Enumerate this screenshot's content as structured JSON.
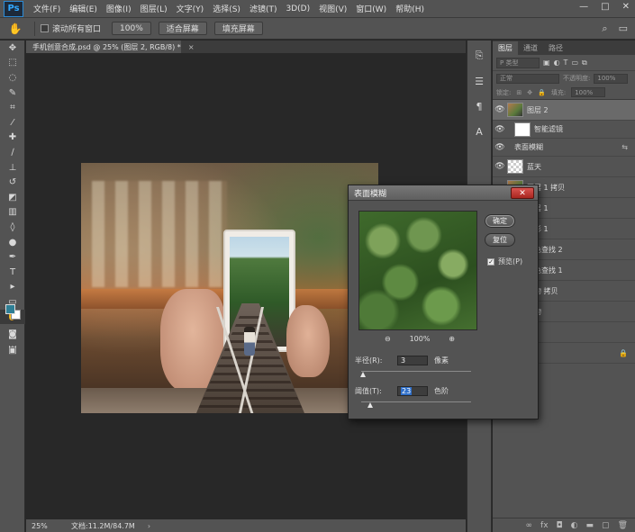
{
  "app": {
    "logo": "Ps"
  },
  "menu": [
    "文件(F)",
    "编辑(E)",
    "图像(I)",
    "图层(L)",
    "文字(Y)",
    "选择(S)",
    "滤镜(T)",
    "3D(D)",
    "视图(V)",
    "窗口(W)",
    "帮助(H)"
  ],
  "window_controls": [
    "—",
    "□",
    "✕"
  ],
  "options_bar": {
    "scroll_all_windows": "滚动所有窗口",
    "zoom_100": "100%",
    "fit_screen": "适合屏幕",
    "fill_screen": "填充屏幕"
  },
  "document": {
    "tab_title": "手机创意合成.psd @ 25% (图层 2, RGB/8) *"
  },
  "status": {
    "zoom": "25%",
    "doc_size": "文档:11.2M/84.7M"
  },
  "layers_panel": {
    "tabs": [
      "图层",
      "通道",
      "路径"
    ],
    "kind_placeholder": "P 类型",
    "blend_mode": "正常",
    "opacity_label": "不透明度:",
    "opacity_value": "100%",
    "lock_label": "锁定:",
    "fill_label": "填充:",
    "fill_value": "100%",
    "layers": [
      {
        "name": "图层 2",
        "thumb": "photo",
        "selected": true,
        "visible": true
      },
      {
        "name": "智能滤镜",
        "thumb": "white",
        "sub": true,
        "visible": true
      },
      {
        "name": "表面模糊",
        "sub": true,
        "visible": true,
        "extra": "⇆"
      },
      {
        "name": "蓝天",
        "thumb": "check",
        "visible": true
      },
      {
        "name": "图层 1 拷贝",
        "thumb": "photo",
        "visible": false
      },
      {
        "name": "图层 1",
        "thumb": "photo",
        "visible": false
      },
      {
        "name": "矩形 1",
        "thumb": "white",
        "visible": false
      },
      {
        "name": "颜色查找 2",
        "thumb": "white",
        "visible": false
      },
      {
        "name": "颜色查找 1",
        "thumb": "white",
        "visible": false
      },
      {
        "name": "素物 拷贝",
        "thumb": "black",
        "visible": false
      },
      {
        "name": "景物",
        "thumb": "black",
        "visible": false
      },
      {
        "name": "手机",
        "visible": false
      },
      {
        "name": "背景",
        "visible": false,
        "extra": "🔒"
      }
    ]
  },
  "dialog": {
    "title": "表面模糊",
    "close": "✕",
    "ok": "确定",
    "reset": "复位",
    "preview_label": "预览(P)",
    "preview_checked": true,
    "zoom_out": "⊖",
    "zoom_level": "100%",
    "zoom_in": "⊕",
    "radius_label": "半径(R):",
    "radius_value": "3",
    "radius_unit": "像素",
    "threshold_label": "阈值(T):",
    "threshold_value": "23",
    "threshold_unit": "色阶",
    "radius_slider_fraction": 0.02,
    "threshold_slider_fraction": 0.08
  }
}
